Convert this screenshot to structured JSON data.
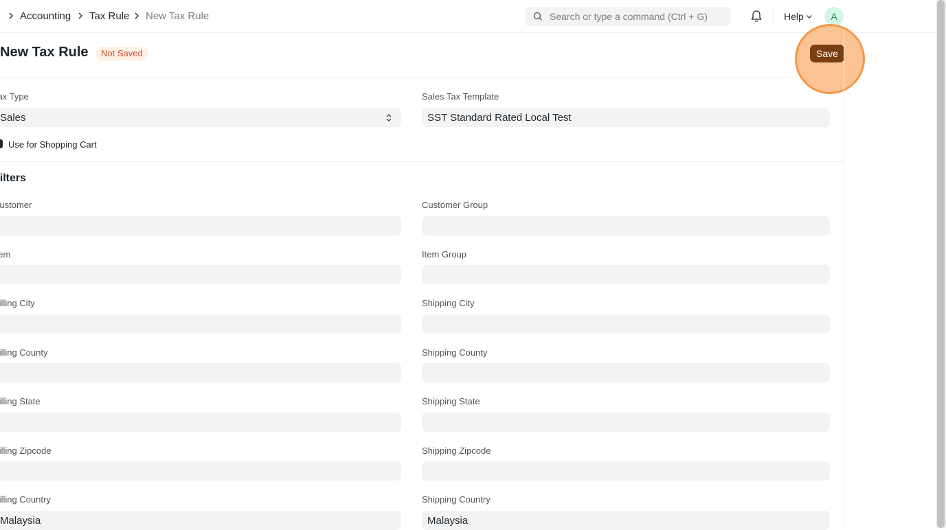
{
  "breadcrumb": {
    "items": [
      "Accounting",
      "Tax Rule"
    ],
    "current": "New Tax Rule"
  },
  "search": {
    "placeholder": "Search or type a command (Ctrl + G)"
  },
  "navbar": {
    "help_label": "Help",
    "avatar_initial": "A"
  },
  "page": {
    "title": "New Tax Rule",
    "status_badge": "Not Saved",
    "save_label": "Save"
  },
  "form": {
    "tax_type": {
      "label": "Tax Type",
      "value": "Sales"
    },
    "sales_tax_template": {
      "label": "Sales Tax Template",
      "value": "SST Standard Rated Local Test"
    },
    "use_for_shopping_cart": {
      "label": "Use for Shopping Cart",
      "checked": true
    },
    "filters_title": "Filters",
    "customer": {
      "label": "Customer",
      "value": ""
    },
    "customer_group": {
      "label": "Customer Group",
      "value": ""
    },
    "item": {
      "label": "Item",
      "value": ""
    },
    "item_group": {
      "label": "Item Group",
      "value": ""
    },
    "billing_city": {
      "label": "Billing City",
      "value": ""
    },
    "shipping_city": {
      "label": "Shipping City",
      "value": ""
    },
    "billing_county": {
      "label": "Billing County",
      "value": ""
    },
    "shipping_county": {
      "label": "Shipping County",
      "value": ""
    },
    "billing_state": {
      "label": "Billing State",
      "value": ""
    },
    "shipping_state": {
      "label": "Shipping State",
      "value": ""
    },
    "billing_zipcode": {
      "label": "Billing Zipcode",
      "value": ""
    },
    "shipping_zipcode": {
      "label": "Shipping Zipcode",
      "value": ""
    },
    "billing_country": {
      "label": "Billing Country",
      "value": "Malaysia"
    },
    "shipping_country": {
      "label": "Shipping Country",
      "value": "Malaysia"
    }
  },
  "colors": {
    "save_button": "#7a3e13",
    "save_highlight": "#f5913e",
    "badge_bg": "#fff0e6",
    "badge_text": "#c8502d",
    "field_bg": "#f3f3f3"
  }
}
